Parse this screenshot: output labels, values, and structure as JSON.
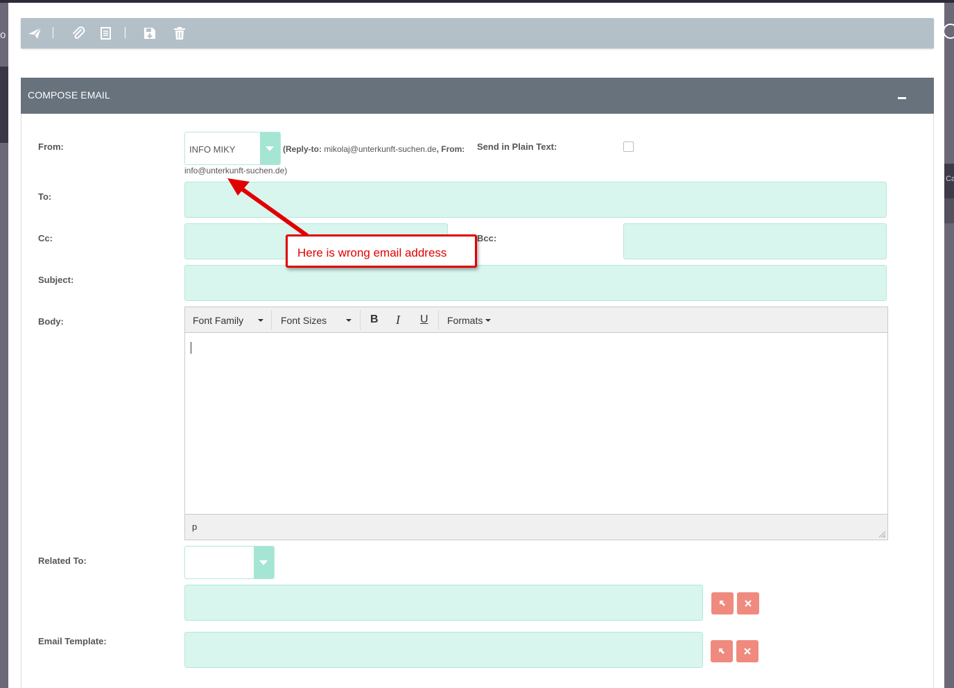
{
  "background": {
    "left_letter": "o",
    "right_letter": "Cat"
  },
  "toolbar": {
    "icons": [
      "send-icon",
      "attachment-icon",
      "document-icon",
      "save-draft-icon",
      "trash-icon"
    ]
  },
  "panel": {
    "title": "COMPOSE EMAIL"
  },
  "form": {
    "from_label": "From:",
    "from_value": "INFO MIKY",
    "from_reply_prefix": "(Reply-to: ",
    "from_reply_email": "mikolaj@unterkunft-suchen.de",
    "from_from_label": ", From:",
    "from_from_email": "info@unterkunft-suchen.de)",
    "plain_text_label": "Send in Plain Text:",
    "to_label": "To:",
    "cc_label": "Cc:",
    "bcc_label": "Bcc:",
    "subject_label": "Subject:",
    "body_label": "Body:",
    "related_label": "Related To:",
    "template_label": "Email Template:"
  },
  "editor": {
    "font_family": "Font Family",
    "font_sizes": "Font Sizes",
    "bold": "B",
    "italic": "I",
    "underline": "U",
    "formats": "Formats",
    "path": "p"
  },
  "annotation": {
    "text": "Here is wrong email address"
  },
  "colors": {
    "field_bg": "#d8f5ee",
    "header_bg": "#67727d",
    "toolbar_bg": "#b4c0c8",
    "button_pink": "#f08a7e",
    "annotation_red": "#e00000"
  }
}
